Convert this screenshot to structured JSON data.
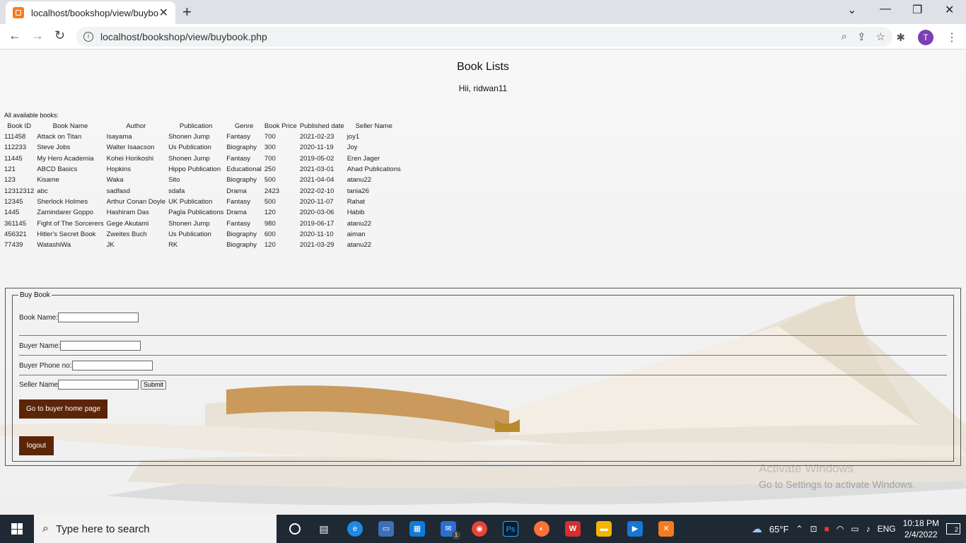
{
  "browser": {
    "tab_title": "localhost/bookshop/view/buybo",
    "url": "localhost/bookshop/view/buybook.php",
    "avatar_letter": "T"
  },
  "page": {
    "title": "Book Lists",
    "greeting": "Hii, ridwan11",
    "available_label": "All available books:"
  },
  "table": {
    "headers": [
      "Book ID",
      "Book Name",
      "Author",
      "Publication",
      "Genre",
      "Book Price",
      "Published date",
      "Seller Name"
    ],
    "rows": [
      [
        "111458",
        "Attack on Titan",
        "Isayama",
        "Shonen Jump",
        "Fantasy",
        "700",
        "2021-02-23",
        "joy1"
      ],
      [
        "112233",
        "Steve Jobs",
        "Walter Isaacson",
        "Us Publication",
        "Biography",
        "300",
        "2020-11-19",
        "Joy"
      ],
      [
        "11445",
        "My Hero Academia",
        "Kohei Horikoshi",
        "Shonen Jump",
        "Fantasy",
        "700",
        "2019-05-02",
        "Eren Jager"
      ],
      [
        "121",
        "ABCD Basics",
        "Hopkins",
        "Hippo Publication",
        "Educational",
        "250",
        "2021-03-01",
        "Ahad Publications"
      ],
      [
        "123",
        "Kisame",
        "Waka",
        "Sito",
        "Biography",
        "500",
        "2021-04-04",
        "atanu22"
      ],
      [
        "12312312",
        "abc",
        "sadfasd",
        "sdafa",
        "Drama",
        "2423",
        "2022-02-10",
        "tania26"
      ],
      [
        "12345",
        "Sherlock Holmes",
        "Arthur Conan Doyle",
        "UK Publication",
        "Fantasy",
        "500",
        "2020-11-07",
        "Rahat"
      ],
      [
        "1445",
        "Zamindarer Goppo",
        "Hashiram Das",
        "Pagla Publications",
        "Drama",
        "120",
        "2020-03-06",
        "Habib"
      ],
      [
        "361145",
        "Fight of The Sorcerers",
        "Gege Akutami",
        "Shonen Jump",
        "Fantasy",
        "980",
        "2019-06-17",
        "atanu22"
      ],
      [
        "456321",
        "Hitler's Secret Book",
        "Zweites Buch",
        "Us Publication",
        "Biography",
        "600",
        "2020-11-10",
        "aiman"
      ],
      [
        "77439",
        "WatashiWa",
        "JK",
        "RK",
        "Biography",
        "120",
        "2021-03-29",
        "atanu22"
      ]
    ]
  },
  "form": {
    "legend": "Buy Book",
    "book_name_label": "Book Name:",
    "buyer_name_label": "Buyer Name:",
    "buyer_phone_label": "Buyer Phone no:",
    "seller_name_label": "Seller Name",
    "submit_label": "Submit",
    "buyer_home_button": "Go to buyer home page",
    "logout_button": "logout"
  },
  "watermark": {
    "line1": "Activate Windows",
    "line2": "Go to Settings to activate Windows."
  },
  "taskbar": {
    "search_placeholder": "Type here to search",
    "temperature": "65°F",
    "language": "ENG",
    "time": "10:18 PM",
    "date": "2/4/2022",
    "notification_count": "2",
    "mail_badge": "1"
  }
}
